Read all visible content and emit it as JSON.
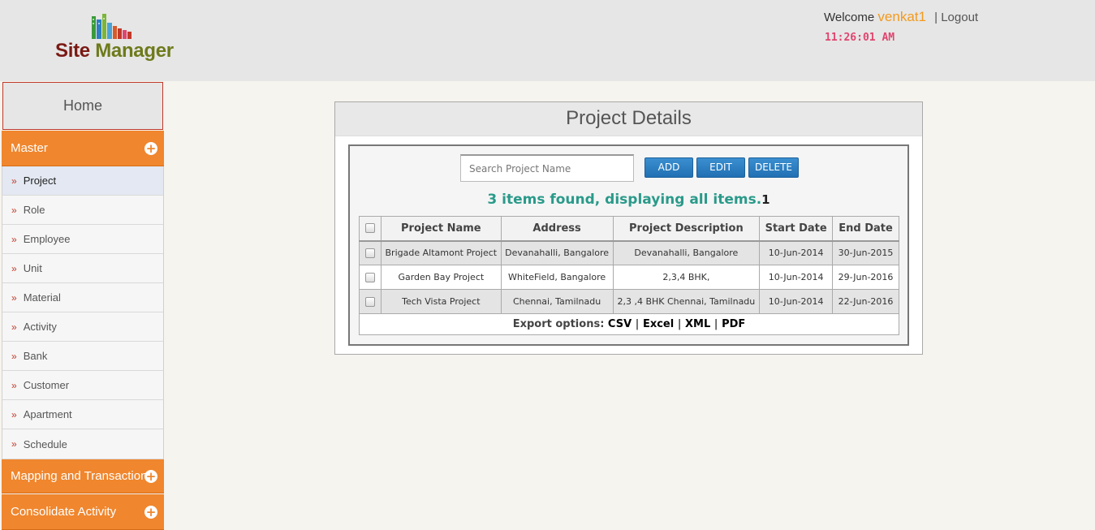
{
  "app": {
    "logo_word1": "Site",
    "logo_word2": "Manager"
  },
  "header": {
    "welcome": "Welcome",
    "user": "venkat1",
    "separator": "|",
    "logout": "Logout",
    "time": "11:26:01 AM"
  },
  "sidebar": {
    "home": "Home",
    "master": "Master",
    "items": [
      {
        "label": "Project"
      },
      {
        "label": "Role"
      },
      {
        "label": "Employee"
      },
      {
        "label": "Unit"
      },
      {
        "label": "Material"
      },
      {
        "label": "Activity"
      },
      {
        "label": "Bank"
      },
      {
        "label": "Customer"
      },
      {
        "label": "Apartment"
      },
      {
        "label": "Schedule"
      }
    ],
    "mapping": "Mapping and Transaction",
    "consolidate": "Consolidate Activity",
    "bullet": "»",
    "plus": "+"
  },
  "main": {
    "title": "Project Details",
    "search_placeholder": "Search Project Name",
    "add": "ADD",
    "edit": "EDIT",
    "delete": "DELETE",
    "found_text": "3 items found, displaying all items.",
    "page": "1",
    "columns": [
      "Project Name",
      "Address",
      "Project Description",
      "Start Date",
      "End Date"
    ],
    "rows": [
      [
        "Brigade Altamont Project",
        "Devanahalli, Bangalore",
        "Devanahalli, Bangalore",
        "10-Jun-2014",
        "30-Jun-2015"
      ],
      [
        "Garden Bay Project",
        "WhiteField, Bangalore",
        "2,3,4 BHK,",
        "10-Jun-2014",
        "29-Jun-2016"
      ],
      [
        "Tech Vista Project",
        "Chennai, Tamilnadu",
        "2,3 ,4 BHK Chennai, Tamilnadu",
        "10-Jun-2014",
        "22-Jun-2016"
      ]
    ],
    "export_label": "Export options:",
    "export": [
      "CSV",
      "Excel",
      "XML",
      "PDF"
    ],
    "export_sep": "|"
  },
  "colors": {
    "accent": "#f0862d",
    "button": "#2a7fc4",
    "found": "#2a9a8a",
    "clock": "#e0456e"
  }
}
